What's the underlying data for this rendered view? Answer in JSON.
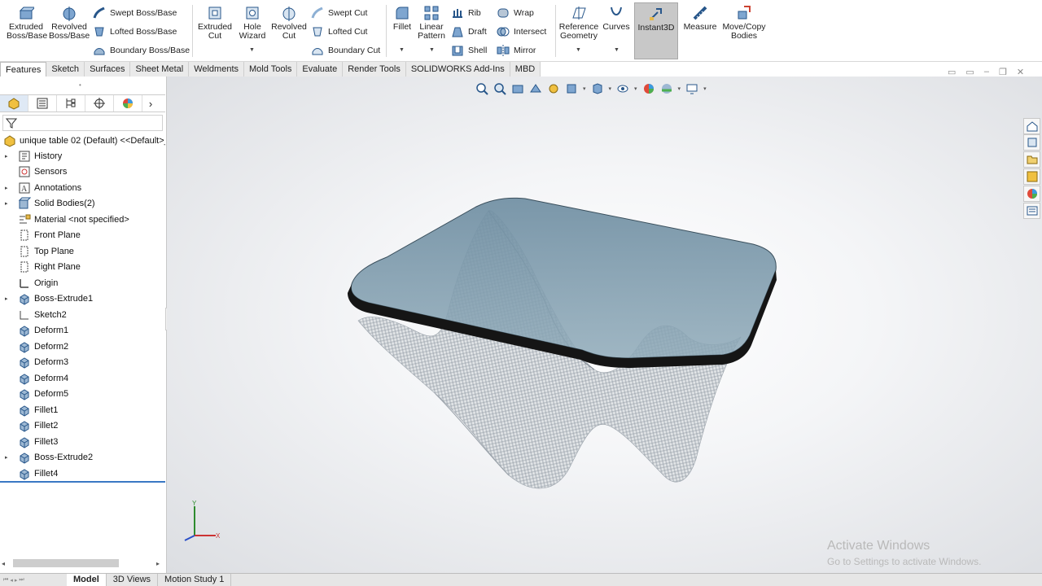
{
  "ribbon": {
    "extruded_boss": "Extruded Boss/Base",
    "revolved_boss": "Revolved Boss/Base",
    "swept_boss": "Swept Boss/Base",
    "lofted_boss": "Lofted Boss/Base",
    "boundary_boss": "Boundary Boss/Base",
    "extruded_cut": "Extruded Cut",
    "hole_wizard": "Hole Wizard",
    "revolved_cut": "Revolved Cut",
    "swept_cut": "Swept Cut",
    "lofted_cut": "Lofted Cut",
    "boundary_cut": "Boundary Cut",
    "fillet": "Fillet",
    "linear_pattern": "Linear Pattern",
    "rib": "Rib",
    "draft": "Draft",
    "shell": "Shell",
    "wrap": "Wrap",
    "intersect": "Intersect",
    "mirror": "Mirror",
    "reference_geometry": "Reference Geometry",
    "curves": "Curves",
    "instant3d": "Instant3D",
    "measure": "Measure",
    "move_copy": "Move/Copy Bodies"
  },
  "tabs": [
    "Features",
    "Sketch",
    "Surfaces",
    "Sheet Metal",
    "Weldments",
    "Mold Tools",
    "Evaluate",
    "Render Tools",
    "SOLIDWORKS Add-Ins",
    "MBD"
  ],
  "tree": {
    "root": "unique table 02 (Default) <<Default>_",
    "items": [
      {
        "label": "History",
        "exp": "▸",
        "icon": "history-icon"
      },
      {
        "label": "Sensors",
        "exp": "",
        "icon": "sensors-icon"
      },
      {
        "label": "Annotations",
        "exp": "▸",
        "icon": "annotations-icon"
      },
      {
        "label": "Solid Bodies(2)",
        "exp": "▸",
        "icon": "solid-bodies-icon"
      },
      {
        "label": "Material <not specified>",
        "exp": "",
        "icon": "material-icon"
      },
      {
        "label": "Front Plane",
        "exp": "",
        "icon": "plane-icon"
      },
      {
        "label": "Top Plane",
        "exp": "",
        "icon": "plane-icon"
      },
      {
        "label": "Right Plane",
        "exp": "",
        "icon": "plane-icon"
      },
      {
        "label": "Origin",
        "exp": "",
        "icon": "origin-icon"
      },
      {
        "label": "Boss-Extrude1",
        "exp": "▸",
        "icon": "feature-icon"
      },
      {
        "label": "Sketch2",
        "exp": "",
        "icon": "sketch-icon"
      },
      {
        "label": "Deform1",
        "exp": "",
        "icon": "feature-icon"
      },
      {
        "label": "Deform2",
        "exp": "",
        "icon": "feature-icon"
      },
      {
        "label": "Deform3",
        "exp": "",
        "icon": "feature-icon"
      },
      {
        "label": "Deform4",
        "exp": "",
        "icon": "feature-icon"
      },
      {
        "label": "Deform5",
        "exp": "",
        "icon": "feature-icon"
      },
      {
        "label": "Fillet1",
        "exp": "",
        "icon": "feature-icon"
      },
      {
        "label": "Fillet2",
        "exp": "",
        "icon": "feature-icon"
      },
      {
        "label": "Fillet3",
        "exp": "",
        "icon": "feature-icon"
      },
      {
        "label": "Boss-Extrude2",
        "exp": "▸",
        "icon": "feature-icon"
      },
      {
        "label": "Fillet4",
        "exp": "",
        "icon": "feature-icon"
      }
    ]
  },
  "bottom_tabs": [
    "Model",
    "3D Views",
    "Motion Study 1"
  ],
  "watermark": {
    "line1": "Activate Windows",
    "line2": "Go to Settings to activate Windows."
  },
  "colors": {
    "accent": "#1f6fc1",
    "glass": "#7d98a8",
    "base": "#c9cdd2"
  }
}
